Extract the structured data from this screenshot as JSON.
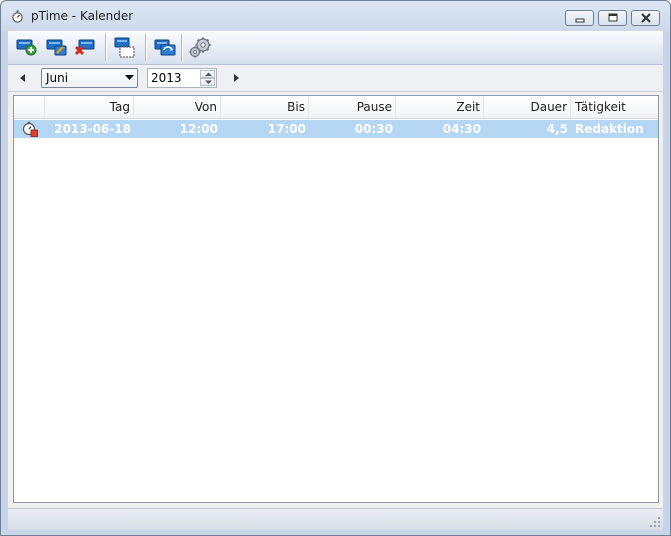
{
  "window": {
    "title": "pTime - Kalender"
  },
  "toolbar": {
    "buttons": [
      {
        "name": "add-entry-icon"
      },
      {
        "name": "edit-entry-icon"
      },
      {
        "name": "delete-entry-icon"
      },
      {
        "name": "select-entries-icon"
      },
      {
        "name": "refresh-entries-icon"
      },
      {
        "name": "settings-gears-icon"
      }
    ]
  },
  "nav": {
    "month": "Juni",
    "year": "2013"
  },
  "table": {
    "columns": [
      "",
      "Tag",
      "Von",
      "Bis",
      "Pause",
      "Zeit",
      "Dauer",
      "Tätigkeit"
    ],
    "rows": [
      {
        "icon": "timer-entry-icon",
        "tag": "2013-06-18",
        "von": "12:00",
        "bis": "17:00",
        "pause": "00:30",
        "zeit": "04:30",
        "dauer": "4,5",
        "taetigkeit": "Redaktion"
      }
    ]
  },
  "colors": {
    "selection": "#b5d7f4",
    "accent_blue": "#1f6fc7",
    "delete_red": "#d42a1e"
  }
}
